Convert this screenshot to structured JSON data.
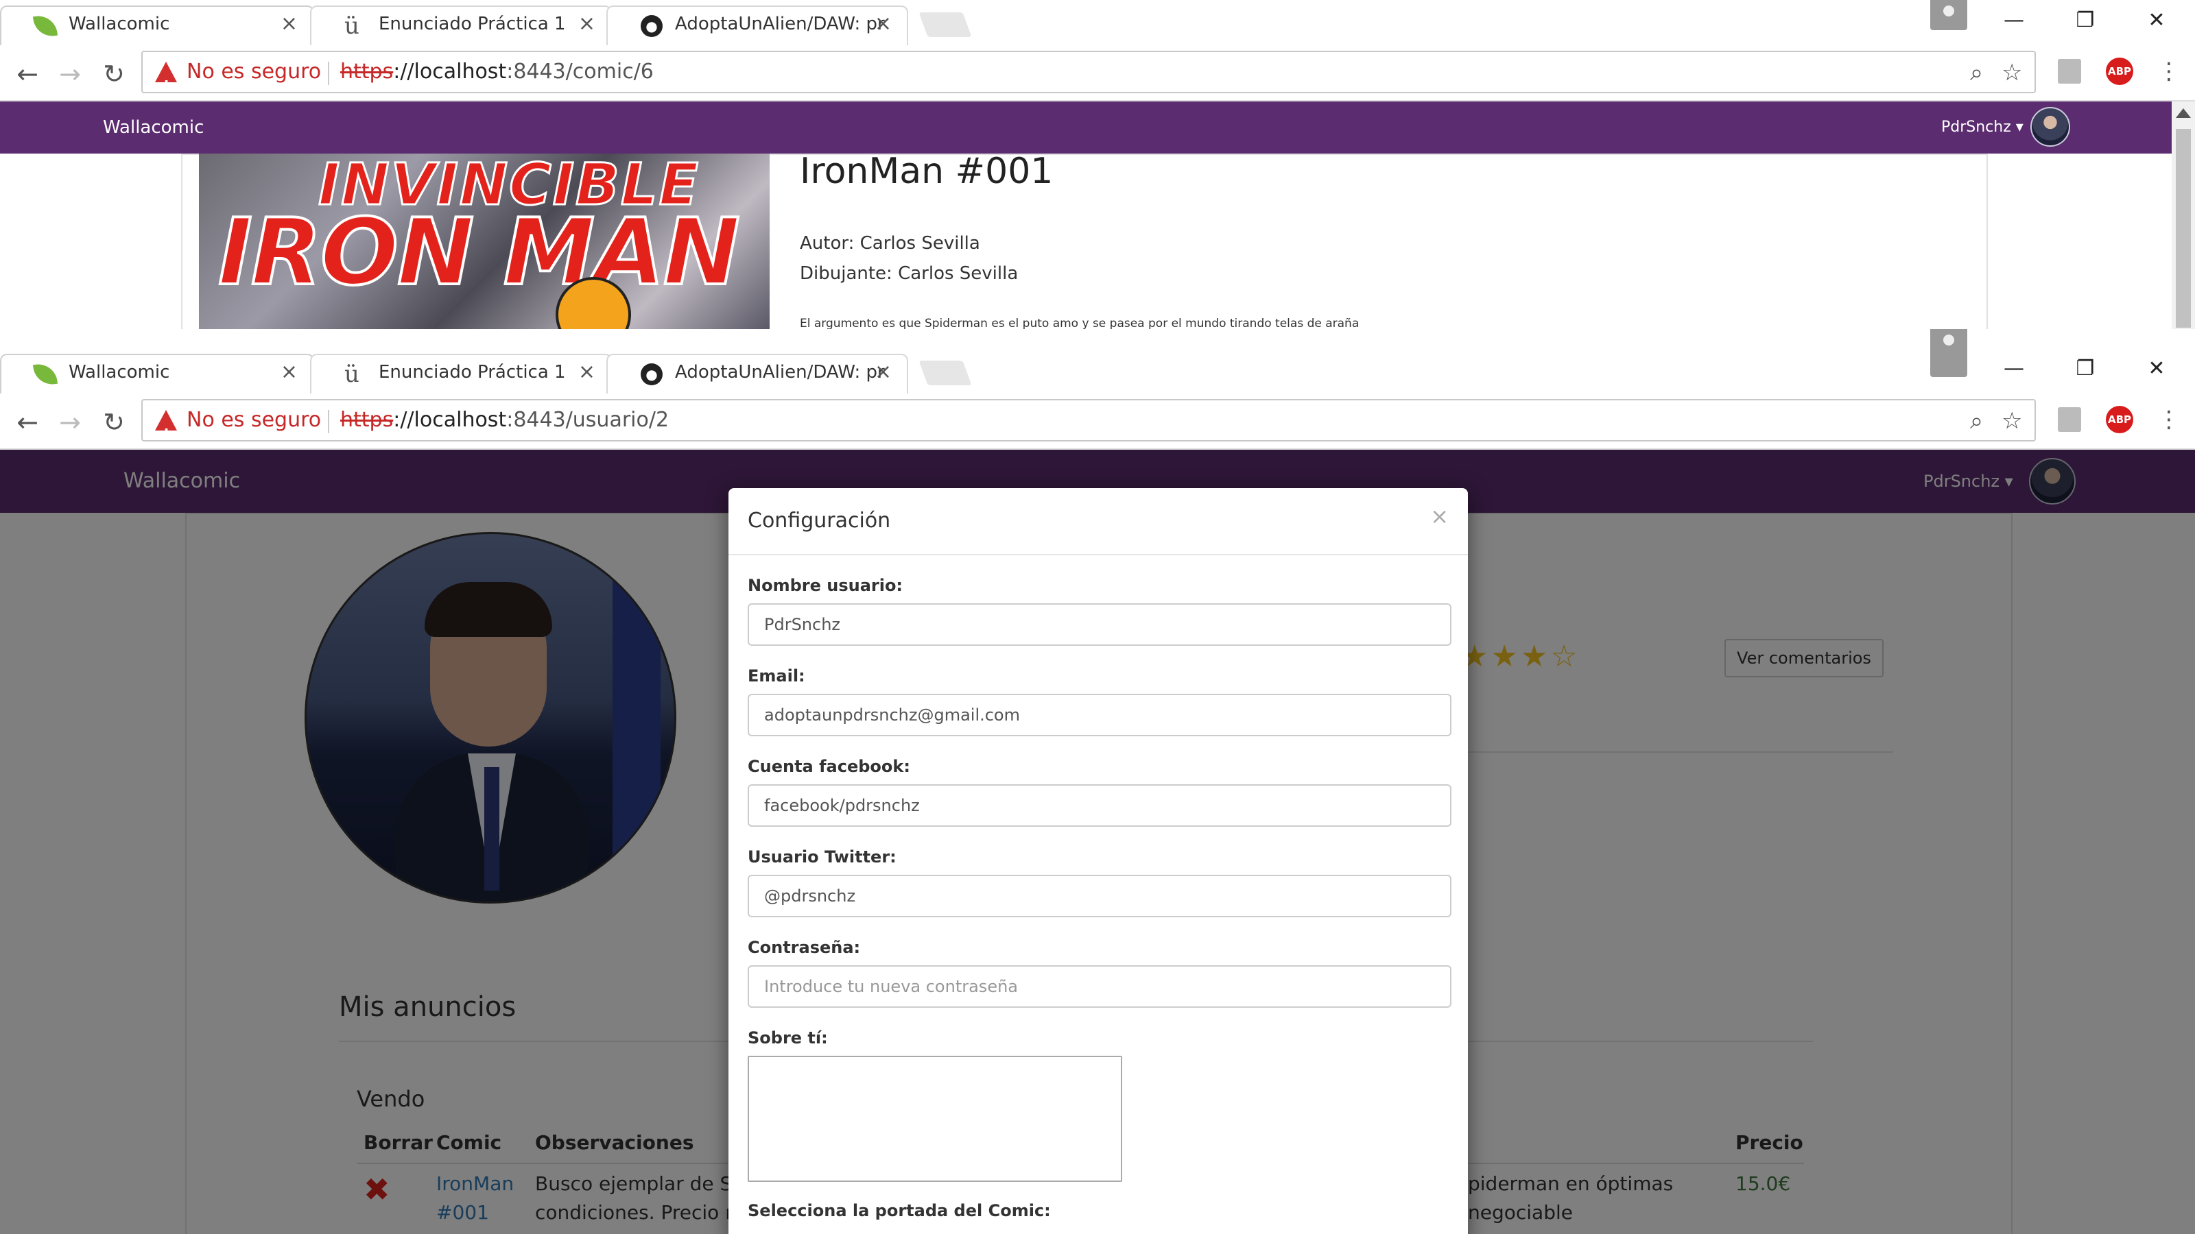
{
  "window1": {
    "tabs": [
      {
        "label": "Wallacomic",
        "icon": "spring-leaf-icon"
      },
      {
        "label": "Enunciado Práctica 1",
        "icon": "ucm-icon"
      },
      {
        "label": "AdoptaUnAlien/DAW: pr",
        "icon": "github-icon"
      }
    ],
    "address": {
      "security_label": "No es seguro",
      "scheme": "https",
      "host": "://localhost",
      "path": ":8443/comic/6"
    },
    "navbar": {
      "brand": "Wallacomic",
      "user": "PdrSnchz ▾"
    },
    "comic": {
      "title": "IronMan #001",
      "author": "Autor: Carlos Sevilla",
      "artist": "Dibujante: Carlos Sevilla",
      "description": "El argumento es que Spiderman es el puto amo y se pasea por el mundo tirando telas de araña",
      "cover_line1": "INVINCIBLE",
      "cover_line2": "IRON MAN"
    }
  },
  "window2": {
    "tabs": [
      {
        "label": "Wallacomic",
        "icon": "spring-leaf-icon"
      },
      {
        "label": "Enunciado Práctica 1",
        "icon": "ucm-icon"
      },
      {
        "label": "AdoptaUnAlien/DAW: pr",
        "icon": "github-icon"
      }
    ],
    "address": {
      "security_label": "No es seguro",
      "scheme": "https",
      "host": "://localhost",
      "path": ":8443/usuario/2"
    },
    "navbar": {
      "brand": "Wallacomic",
      "user": "PdrSnchz ▾"
    },
    "profile": {
      "rating_stars": "★★★☆",
      "comments_button": "Ver comentarios"
    },
    "listings": {
      "heading": "Mis anuncios",
      "section": "Vendo",
      "columns": [
        "Borrar",
        "Comic",
        "Observaciones",
        "Precio"
      ],
      "rows": [
        {
          "comic_line1": "IronMan",
          "comic_line2": "#001",
          "obs_left1": "Busco ejemplar de Sp",
          "obs_left2": "condiciones. Precio ne",
          "obs_right1": "piderman en óptimas",
          "obs_right2": "negociable",
          "price": "15.0€"
        }
      ]
    },
    "modal": {
      "title": "Configuración",
      "close": "×",
      "fields": {
        "username_label": "Nombre usuario:",
        "username_value": "PdrSnchz",
        "email_label": "Email:",
        "email_value": "adoptaunpdrsnchz@gmail.com",
        "facebook_label": "Cuenta facebook:",
        "facebook_value": "facebook/pdrsnchz",
        "twitter_label": "Usuario Twitter:",
        "twitter_value": "@pdrsnchz",
        "password_label": "Contraseña:",
        "password_placeholder": "Introduce tu nueva contraseña",
        "about_label": "Sobre tí:",
        "cover_label": "Selecciona la portada del Comic:"
      }
    }
  },
  "colors": {
    "navbar": "#5b2c6f",
    "link": "#337ab7",
    "danger": "#d9221c",
    "star": "#f3c322"
  }
}
